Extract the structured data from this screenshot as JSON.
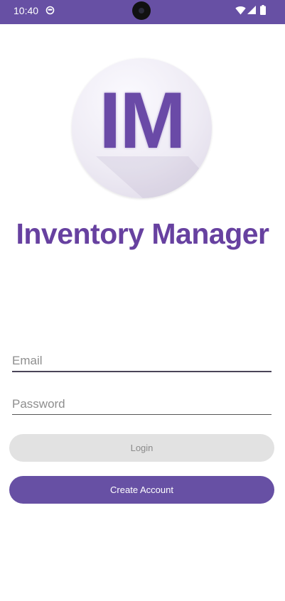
{
  "status_bar": {
    "time": "10:40",
    "icons": [
      "notification-icon",
      "wifi-icon",
      "signal-icon",
      "battery-icon"
    ],
    "background": "#6750a4"
  },
  "logo": {
    "text": "IM",
    "color": "#6a4aa7"
  },
  "app": {
    "title": "Inventory Manager",
    "title_color": "#6741a0"
  },
  "form": {
    "email_placeholder": "Email",
    "email_value": "",
    "password_placeholder": "Password",
    "password_value": ""
  },
  "buttons": {
    "login_label": "Login",
    "login_state": "disabled",
    "create_account_label": "Create Account",
    "create_account_color": "#6750a4"
  }
}
